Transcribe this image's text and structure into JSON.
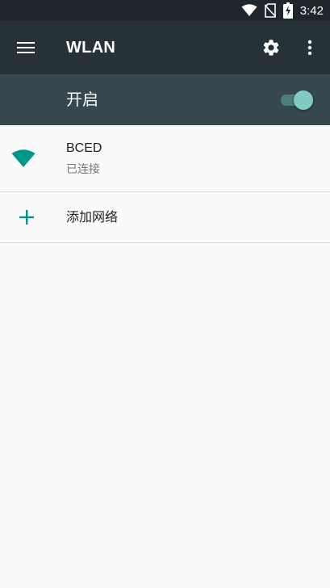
{
  "status_bar": {
    "time": "3:42",
    "icons": [
      "wifi-icon",
      "no-sim-icon",
      "battery-charging-icon"
    ]
  },
  "app_bar": {
    "title": "WLAN",
    "icons": [
      "menu-icon",
      "gear-icon",
      "more-vert-icon"
    ]
  },
  "master_switch": {
    "label": "开启",
    "checked": true
  },
  "networks": [
    {
      "name": "BCED",
      "status": "已连接",
      "icon": "wifi-signal-full-icon"
    }
  ],
  "add_network": {
    "label": "添加网络",
    "icon": "plus-icon"
  },
  "colors": {
    "status_bar": "#1e272c",
    "app_bar": "#263238",
    "switch_bar": "#37474f",
    "accent": "#009688",
    "toggle_thumb": "#80cbc4",
    "background": "#fafafa"
  }
}
